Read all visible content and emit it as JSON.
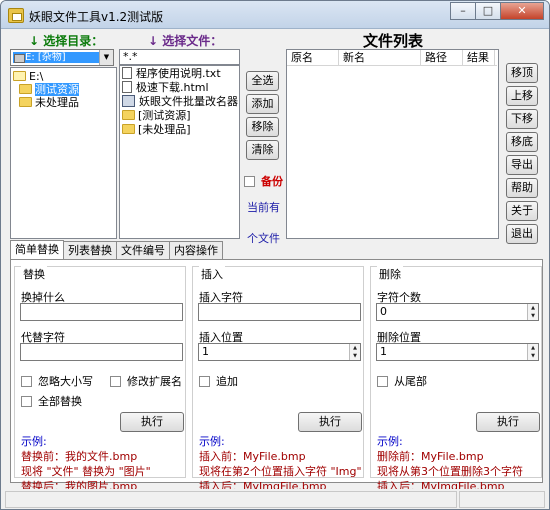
{
  "window": {
    "title": "妖眼文件工具v1.2测试版",
    "buttons": {
      "minimize": "–",
      "maximize": "□",
      "close": "✕"
    }
  },
  "dir_panel": {
    "label": "↓ 选择目录：",
    "drive": "E: [杂物]",
    "tree": [
      {
        "label": "E:\\",
        "icon": "folder-open-icon"
      },
      {
        "label": "测试资源",
        "icon": "folder-icon",
        "selected": true
      },
      {
        "label": "未处理品",
        "icon": "folder-icon"
      }
    ]
  },
  "file_panel": {
    "label": "↓ 选择文件：",
    "filter": "*.*",
    "files": [
      {
        "label": "程序使用说明.txt",
        "icon": "file-icon"
      },
      {
        "label": "极速下载.html",
        "icon": "file-icon"
      },
      {
        "label": "妖眼文件批量改名器.e",
        "icon": "app-icon"
      },
      {
        "label": "[测试资源]",
        "icon": "folder-icon"
      },
      {
        "label": "[未处理品]",
        "icon": "folder-icon"
      }
    ]
  },
  "mid_buttons": {
    "select_all": "全选",
    "add": "添加",
    "remove": "移除",
    "clear": "清除"
  },
  "backup": {
    "label": "备份"
  },
  "current_text": {
    "line1": "当前有",
    "line2": "个文件"
  },
  "file_list": {
    "title": "文件列表",
    "columns": {
      "orig": "原名",
      "new": "新名",
      "path": "路径",
      "result": "结果"
    }
  },
  "right_buttons": {
    "top": "移顶",
    "up": "上移",
    "down": "下移",
    "bottom": "移底",
    "export": "导出",
    "help": "帮助",
    "about": "关于",
    "exit": "退出"
  },
  "tabs": {
    "simple": "简单替换",
    "list_replace": "列表替换",
    "file_number": "文件编号",
    "content": "内容操作"
  },
  "replace": {
    "title": "替换",
    "find_label": "换掉什么",
    "replace_label": "代替字符",
    "ignore_case": "忽略大小写",
    "modify_ext": "修改扩展名",
    "replace_all": "全部替换",
    "run": "执行",
    "example_title": "示例:",
    "ex1": "替换前：我的文件.bmp",
    "ex2": "现将 \"文件\" 替换为 \"图片\"",
    "ex3": "替换后：我的图片.bmp"
  },
  "insert": {
    "title": "插入",
    "char_label": "插入字符",
    "pos_label": "插入位置",
    "pos_value": "1",
    "append": "追加",
    "run": "执行",
    "example_title": "示例:",
    "ex1": "插入前：MyFile.bmp",
    "ex2": "现将在第2个位置插入字符 \"Img\"",
    "ex3": "插入后：MyImgFile.bmp"
  },
  "delete": {
    "title": "删除",
    "count_label": "字符个数",
    "count_value": "0",
    "pos_label": "删除位置",
    "pos_value": "1",
    "from_end": "从尾部",
    "run": "执行",
    "example_title": "示例:",
    "ex1": "删除前：MyFile.bmp",
    "ex2": "现将从第3个位置删除3个字符",
    "ex3": "插入后：MyImgFile.bmp"
  }
}
